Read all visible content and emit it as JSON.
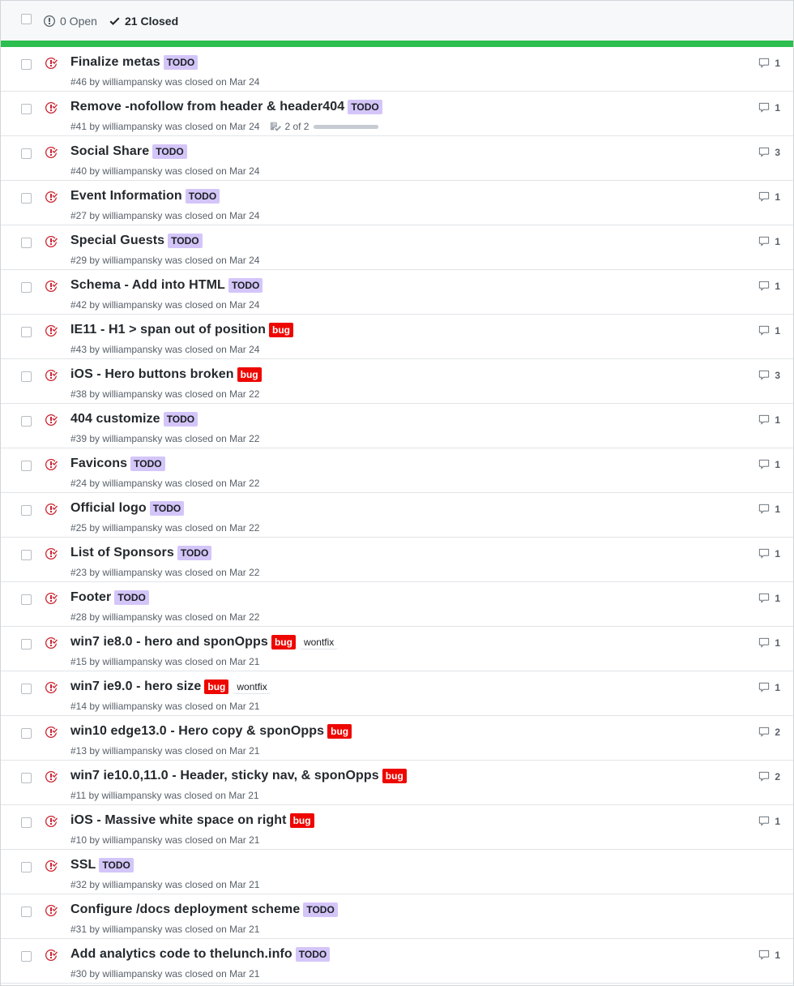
{
  "header": {
    "open_label": "0 Open",
    "closed_label": "21 Closed"
  },
  "colors": {
    "progress": "#2cbe4e",
    "closed_icon": "#cb2431",
    "todo_label": "#d4c5f9",
    "bug_label": "#ee0701"
  },
  "issues": [
    {
      "title": "Finalize metas",
      "labels": [
        "TODO"
      ],
      "meta": "#46 by williampansky was closed on Mar 24",
      "comments": "1"
    },
    {
      "title": "Remove -nofollow from header & header404",
      "labels": [
        "TODO"
      ],
      "meta": "#41 by williampansky was closed on Mar 24",
      "tasks": "2 of 2",
      "tasks_fraction": 1,
      "comments": "1"
    },
    {
      "title": "Social Share",
      "labels": [
        "TODO"
      ],
      "meta": "#40 by williampansky was closed on Mar 24",
      "comments": "3"
    },
    {
      "title": "Event Information",
      "labels": [
        "TODO"
      ],
      "meta": "#27 by williampansky was closed on Mar 24",
      "comments": "1"
    },
    {
      "title": "Special Guests",
      "labels": [
        "TODO"
      ],
      "meta": "#29 by williampansky was closed on Mar 24",
      "comments": "1"
    },
    {
      "title": "Schema - Add into HTML",
      "labels": [
        "TODO"
      ],
      "meta": "#42 by williampansky was closed on Mar 24",
      "comments": "1"
    },
    {
      "title": "IE11 - H1 > span out of position",
      "labels": [
        "bug"
      ],
      "meta": "#43 by williampansky was closed on Mar 24",
      "comments": "1"
    },
    {
      "title": "iOS - Hero buttons broken",
      "labels": [
        "bug"
      ],
      "meta": "#38 by williampansky was closed on Mar 22",
      "comments": "3"
    },
    {
      "title": "404 customize",
      "labels": [
        "TODO"
      ],
      "meta": "#39 by williampansky was closed on Mar 22",
      "comments": "1"
    },
    {
      "title": "Favicons",
      "labels": [
        "TODO"
      ],
      "meta": "#24 by williampansky was closed on Mar 22",
      "comments": "1"
    },
    {
      "title": "Official logo",
      "labels": [
        "TODO"
      ],
      "meta": "#25 by williampansky was closed on Mar 22",
      "comments": "1"
    },
    {
      "title": "List of Sponsors",
      "labels": [
        "TODO"
      ],
      "meta": "#23 by williampansky was closed on Mar 22",
      "comments": "1"
    },
    {
      "title": "Footer",
      "labels": [
        "TODO"
      ],
      "meta": "#28 by williampansky was closed on Mar 22",
      "comments": "1"
    },
    {
      "title": "win7 ie8.0 - hero and sponOpps",
      "labels": [
        "bug",
        "wontfix"
      ],
      "meta": "#15 by williampansky was closed on Mar 21",
      "comments": "1"
    },
    {
      "title": "win7 ie9.0 - hero size",
      "labels": [
        "bug",
        "wontfix"
      ],
      "meta": "#14 by williampansky was closed on Mar 21",
      "comments": "1"
    },
    {
      "title": "win10 edge13.0 - Hero copy & sponOpps",
      "labels": [
        "bug"
      ],
      "meta": "#13 by williampansky was closed on Mar 21",
      "comments": "2"
    },
    {
      "title": "win7 ie10.0,11.0 - Header, sticky nav, & sponOpps",
      "labels": [
        "bug"
      ],
      "meta": "#11 by williampansky was closed on Mar 21",
      "comments": "2"
    },
    {
      "title": "iOS - Massive white space on right",
      "labels": [
        "bug"
      ],
      "meta": "#10 by williampansky was closed on Mar 21",
      "comments": "1"
    },
    {
      "title": "SSL",
      "labels": [
        "TODO"
      ],
      "meta": "#32 by williampansky was closed on Mar 21",
      "comments": ""
    },
    {
      "title": "Configure /docs deployment scheme",
      "labels": [
        "TODO"
      ],
      "meta": "#31 by williampansky was closed on Mar 21",
      "comments": ""
    },
    {
      "title": "Add analytics code to thelunch.info",
      "labels": [
        "TODO"
      ],
      "meta": "#30 by williampansky was closed on Mar 21",
      "comments": "1"
    }
  ]
}
